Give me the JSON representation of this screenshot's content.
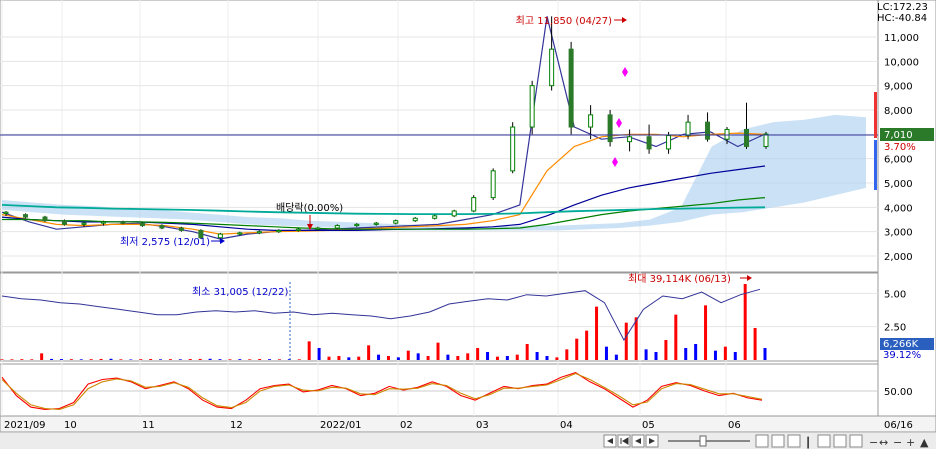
{
  "header": {
    "lc": "LC:172.23",
    "hc": "HC:-40.84"
  },
  "price_panel": {
    "high_label": "최고 11,850 (04/27)",
    "low_label": "최저 2,575 (12/01)",
    "dividend_label": "배당락(0.00%)",
    "current_price": "7,010",
    "change_pct": "3.70%"
  },
  "volume_panel": {
    "min_label": "최소 31,005 (12/22)",
    "max_label": "최대 39,114K (06/13)",
    "current_volume": "6,266K",
    "turnover_pct": "39.12%"
  },
  "osc_panel": {
    "tick": "50.00"
  },
  "x_axis": {
    "labels": [
      "2021/09",
      "10",
      "11",
      "12",
      "2022/01",
      "02",
      "03",
      "04",
      "05",
      "06"
    ],
    "right_date": "06/16"
  },
  "colors": {
    "up": "#ff0000",
    "down": "#0000ff",
    "candle_body": "#008000",
    "ma20": "#ff8c00",
    "ma60": "#000099",
    "ma120": "#008000",
    "ma240": "#00aa99",
    "cloud": "#a8cff0",
    "purple_line": "#333399"
  },
  "toolbar": {
    "buttons": [
      "◀",
      "▶",
      "|◀◀",
      "◀",
      "▶",
      "▶▶|",
      "−",
      "+",
      "▲"
    ]
  },
  "chart_data": [
    {
      "type": "line",
      "title": "",
      "x": [
        "2021/09",
        "10",
        "11",
        "12",
        "2022/01",
        "02",
        "03",
        "04",
        "05",
        "06"
      ],
      "ylim": [
        1500,
        12000
      ],
      "y_ticks": [
        2000,
        3000,
        4000,
        5000,
        6000,
        7000,
        8000,
        9000,
        10000,
        11000
      ],
      "y_tick_labels": [
        "2,000",
        "3,000",
        "4,000",
        "5,000",
        "6,000",
        "7,000",
        "8,000",
        "9,000",
        "10,000",
        "11,000"
      ],
      "series": [
        {
          "values": [
            3800,
            3400,
            3100,
            3200,
            3300,
            3350,
            3200,
            3000,
            2700,
            2900,
            3000,
            3050,
            3100,
            3150,
            3200,
            3250,
            3300,
            3500,
            3700,
            4100,
            11850,
            7300,
            6800,
            6900,
            6500,
            7000,
            7100,
            6500,
            7010
          ]
        },
        {
          "values": [
            3700,
            3500,
            3300,
            3250,
            3300,
            3300,
            3250,
            3100,
            2900,
            2950,
            3000,
            3020,
            3050,
            3100,
            3150,
            3200,
            3250,
            3300,
            3450,
            3700,
            5500,
            6500,
            6900,
            7000,
            7000,
            6900,
            7000,
            7050,
            7000
          ]
        },
        {
          "values": [
            3600,
            3500,
            3450,
            3400,
            3400,
            3400,
            3350,
            3300,
            3200,
            3100,
            3050,
            3050,
            3050,
            3050,
            3080,
            3100,
            3120,
            3150,
            3200,
            3300,
            3650,
            4100,
            4500,
            4800,
            5000,
            5200,
            5400,
            5550,
            5700
          ]
        },
        {
          "values": [
            3500,
            3500,
            3450,
            3450,
            3400,
            3400,
            3380,
            3350,
            3300,
            3250,
            3200,
            3150,
            3120,
            3100,
            3100,
            3100,
            3100,
            3100,
            3120,
            3150,
            3300,
            3500,
            3700,
            3850,
            3950,
            4050,
            4150,
            4300,
            4400
          ]
        },
        {
          "values": [
            4100,
            4050,
            4000,
            3980,
            3950,
            3930,
            3910,
            3890,
            3860,
            3830,
            3800,
            3780,
            3760,
            3740,
            3730,
            3720,
            3720,
            3720,
            3730,
            3750,
            3800,
            3840,
            3870,
            3900,
            3930,
            3950,
            3970,
            3990,
            4000
          ]
        }
      ],
      "candles": [
        [
          3750,
          3850,
          3650,
          3800
        ],
        [
          3700,
          3750,
          3550,
          3600
        ],
        [
          3600,
          3650,
          3400,
          3450
        ],
        [
          3450,
          3500,
          3250,
          3300
        ],
        [
          3300,
          3400,
          3200,
          3350
        ],
        [
          3350,
          3450,
          3250,
          3400
        ],
        [
          3400,
          3450,
          3300,
          3350
        ],
        [
          3350,
          3400,
          3200,
          3250
        ],
        [
          3250,
          3300,
          3100,
          3150
        ],
        [
          3150,
          3200,
          3000,
          3050
        ],
        [
          3050,
          3100,
          2700,
          2750
        ],
        [
          2750,
          2950,
          2575,
          2900
        ],
        [
          2900,
          3000,
          2850,
          2950
        ],
        [
          2950,
          3050,
          2900,
          3000
        ],
        [
          3000,
          3100,
          2950,
          3050
        ],
        [
          3050,
          3150,
          3000,
          3100
        ],
        [
          3100,
          3200,
          3050,
          3150
        ],
        [
          3150,
          3300,
          3100,
          3250
        ],
        [
          3250,
          3350,
          3200,
          3300
        ],
        [
          3300,
          3400,
          3250,
          3350
        ],
        [
          3350,
          3500,
          3300,
          3450
        ],
        [
          3450,
          3600,
          3400,
          3550
        ],
        [
          3550,
          3700,
          3500,
          3650
        ],
        [
          3650,
          3900,
          3600,
          3850
        ],
        [
          3850,
          4500,
          3800,
          4400
        ],
        [
          4400,
          5600,
          4300,
          5500
        ],
        [
          5500,
          7500,
          5400,
          7300
        ],
        [
          7300,
          9200,
          7000,
          9000
        ],
        [
          9000,
          11850,
          8800,
          10500
        ],
        [
          10500,
          10800,
          7000,
          7300
        ],
        [
          7300,
          8200,
          6800,
          7800
        ],
        [
          7800,
          8000,
          6500,
          6700
        ],
        [
          6700,
          7200,
          6300,
          6900
        ],
        [
          6900,
          7400,
          6200,
          6400
        ],
        [
          6400,
          7100,
          6200,
          6950
        ],
        [
          6950,
          7800,
          6800,
          7500
        ],
        [
          7500,
          7900,
          6700,
          6800
        ],
        [
          6800,
          7300,
          6600,
          7200
        ],
        [
          7200,
          8300,
          6400,
          6500
        ],
        [
          6500,
          7100,
          6400,
          7010
        ]
      ],
      "ichimoku_cloud_top": [
        4300,
        4200,
        4100,
        4050,
        3950,
        3900,
        3800,
        3700,
        3600,
        3550,
        3450,
        3400,
        3350,
        3300,
        3250,
        3200,
        3200,
        3250,
        3250,
        3300,
        3350,
        3500,
        4000,
        6500,
        7200,
        7500,
        7600,
        7800,
        7700
      ],
      "ichimoku_cloud_bottom": [
        3900,
        3800,
        3700,
        3650,
        3600,
        3550,
        3500,
        3400,
        3300,
        3250,
        3200,
        3150,
        3100,
        3050,
        3050,
        3050,
        3050,
        3050,
        3050,
        3100,
        3150,
        3250,
        3400,
        3700,
        3800,
        4000,
        4200,
        4500,
        4800
      ]
    },
    {
      "type": "bar",
      "title": "",
      "ylim": [
        0,
        6
      ],
      "y_ticks": [
        2.5,
        5.0
      ],
      "y_tick_labels": [
        "2.50",
        "5.00"
      ],
      "values": [
        0.05,
        0.05,
        0.06,
        0.05,
        0.5,
        0.08,
        0.07,
        0.06,
        0.05,
        0.06,
        0.08,
        0.09,
        0.05,
        0.04,
        0.06,
        0.07,
        0.05,
        0.06,
        0.05,
        0.07,
        0.08,
        0.09,
        0.06,
        0.05,
        0.06,
        0.05,
        0.07,
        0.06,
        0.05,
        0.06,
        0.05,
        1.4,
        0.9,
        0.25,
        0.3,
        0.2,
        0.25,
        1.1,
        0.4,
        0.3,
        0.2,
        0.7,
        0.5,
        0.3,
        1.3,
        0.4,
        0.3,
        0.5,
        0.9,
        0.6,
        0.25,
        0.3,
        0.4,
        1.2,
        0.6,
        0.3,
        0.2,
        0.8,
        1.6,
        2.2,
        4.0,
        1.0,
        0.4,
        2.8,
        3.2,
        0.8,
        0.6,
        1.5,
        3.4,
        0.9,
        1.2,
        4.1,
        0.7,
        1.0,
        0.6,
        5.7,
        2.4,
        0.9
      ],
      "up": [
        1,
        1,
        1,
        1,
        1,
        0,
        0,
        1,
        0,
        1,
        1,
        0,
        1,
        0,
        1,
        1,
        0,
        1,
        0,
        1,
        1,
        0,
        0,
        1,
        0,
        1,
        1,
        0,
        1,
        0,
        1,
        1,
        0,
        1,
        1,
        0,
        1,
        1,
        0,
        1,
        0,
        1,
        0,
        1,
        1,
        0,
        1,
        1,
        1,
        0,
        1,
        0,
        1,
        1,
        0,
        0,
        1,
        1,
        1,
        1,
        1,
        0,
        0,
        1,
        1,
        0,
        0,
        1,
        1,
        0,
        0,
        1,
        0,
        1,
        0,
        1,
        1,
        0
      ],
      "volume_ratio_line": [
        4.8,
        4.6,
        4.5,
        4.3,
        4.2,
        4.0,
        3.8,
        3.6,
        3.4,
        3.4,
        3.6,
        3.7,
        3.6,
        3.7,
        3.5,
        3.6,
        3.4,
        3.5,
        3.4,
        3.3,
        3.1,
        3.3,
        3.6,
        4.2,
        4.4,
        4.6,
        4.5,
        4.9,
        4.8,
        5.0,
        5.2,
        4.3,
        1.5,
        3.8,
        4.8,
        4.6,
        5.1,
        4.3,
        4.9,
        5.3
      ]
    },
    {
      "type": "line",
      "title": "",
      "ylim": [
        0,
        100
      ],
      "y_ticks": [
        50
      ],
      "y_tick_labels": [
        "50.00"
      ],
      "series": [
        {
          "values": [
            80,
            40,
            15,
            10,
            12,
            25,
            65,
            75,
            78,
            70,
            55,
            62,
            70,
            55,
            30,
            15,
            12,
            30,
            55,
            62,
            65,
            48,
            52,
            62,
            55,
            40,
            45,
            60,
            52,
            58,
            70,
            60,
            40,
            30,
            45,
            60,
            55,
            62,
            65,
            80,
            90,
            70,
            55,
            35,
            15,
            30,
            60,
            68,
            62,
            50,
            40,
            45,
            35,
            30
          ]
        },
        {
          "values": [
            75,
            45,
            20,
            12,
            10,
            20,
            55,
            70,
            76,
            72,
            58,
            60,
            68,
            58,
            35,
            18,
            14,
            25,
            50,
            60,
            63,
            52,
            50,
            58,
            56,
            44,
            42,
            55,
            54,
            56,
            66,
            62,
            45,
            33,
            42,
            56,
            56,
            60,
            63,
            75,
            88,
            75,
            58,
            40,
            20,
            26,
            55,
            66,
            64,
            54,
            44,
            44,
            38,
            32
          ]
        }
      ]
    }
  ]
}
